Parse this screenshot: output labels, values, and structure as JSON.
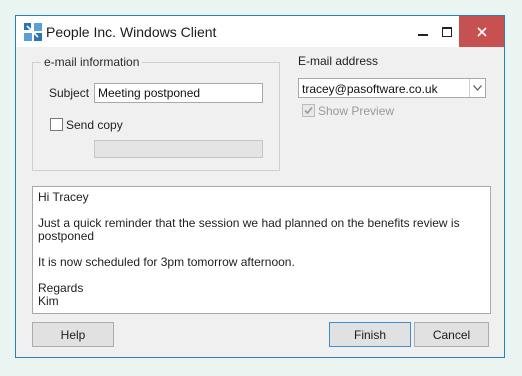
{
  "window": {
    "title": "People Inc. Windows Client"
  },
  "email_group": {
    "title": "e-mail information",
    "subject_label": "Subject",
    "subject_value": "Meeting postponed",
    "send_copy_label": "Send copy",
    "send_copy_checked": false,
    "copy_field_value": ""
  },
  "address": {
    "label": "E-mail address",
    "selected": "tracey@pasoftware.co.uk",
    "show_preview_label": "Show Preview",
    "show_preview_checked": true,
    "show_preview_enabled": false
  },
  "message": {
    "lines": [
      "Hi Tracey",
      "Just a quick reminder that the session we had planned on the benefits review is postponed",
      "It is now scheduled for 3pm tomorrow afternoon.",
      "Regards",
      "Kim"
    ]
  },
  "buttons": {
    "help": "Help",
    "finish": "Finish",
    "cancel": "Cancel"
  },
  "colors": {
    "accent": "#2d7fb8",
    "close": "#c75050"
  }
}
